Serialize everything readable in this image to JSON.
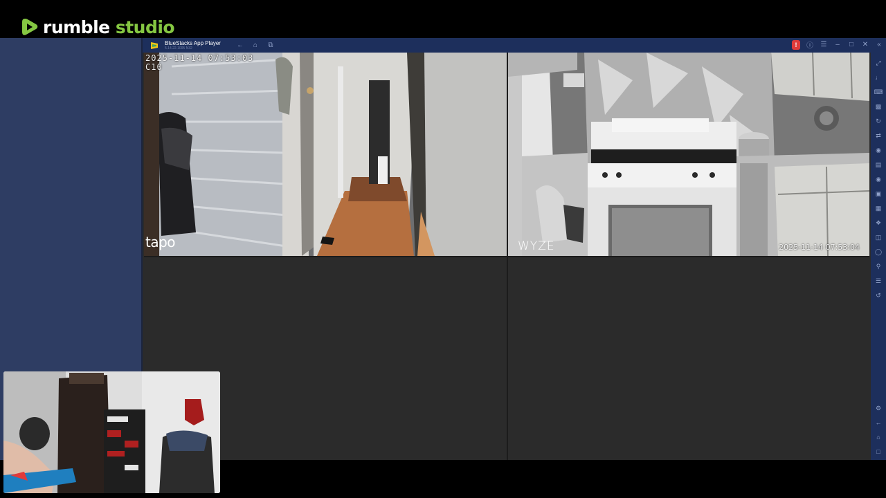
{
  "brand": {
    "name_main": "rumble",
    "name_accent": "studio"
  },
  "bluestacks": {
    "title": "BlueStacks App Player",
    "subtitle": "5.14.22.1005 N32",
    "nav_icons": [
      "back-icon",
      "home-icon",
      "multi-window-icon"
    ],
    "window_controls": [
      "notification-icon",
      "help-icon",
      "menu-icon",
      "minimize-icon",
      "maximize-icon",
      "close-icon",
      "collapse-sidebar-icon"
    ],
    "alert_badge": "!"
  },
  "cameras": [
    {
      "id": "cam-hallway",
      "timestamp": "2025-11-14 07:53:03",
      "label": "C10",
      "brand": "tapo"
    },
    {
      "id": "cam-kitchen",
      "timestamp": "2025-11-14 07:53:04",
      "brand": "WYZE"
    }
  ],
  "colors": {
    "brand_green": "#85c742",
    "side_panel": "#2e3d63",
    "titlebar": "#1d2f5c",
    "grid_bg": "#2b2b2b"
  }
}
